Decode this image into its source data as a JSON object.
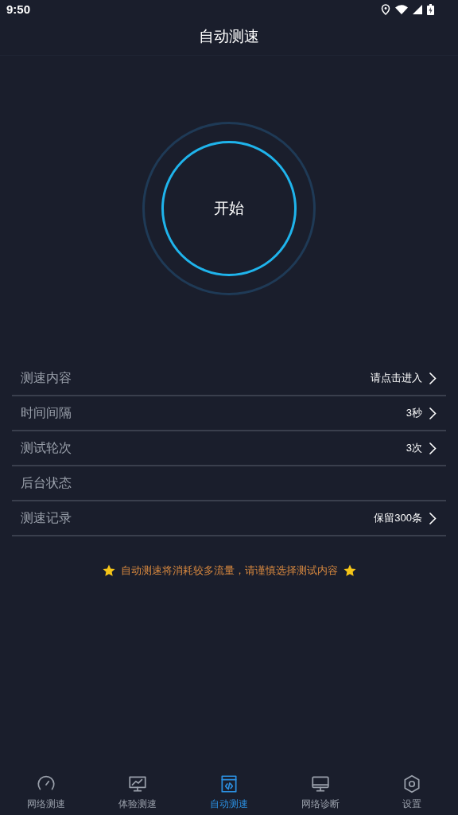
{
  "status_bar": {
    "time": "9:50"
  },
  "header": {
    "title": "自动测速"
  },
  "start_button": {
    "label": "开始"
  },
  "settings": [
    {
      "kind": "link",
      "label": "测速内容",
      "value": "请点击进入"
    },
    {
      "kind": "link",
      "label": "时间间隔",
      "value": "3秒"
    },
    {
      "kind": "link",
      "label": "测试轮次",
      "value": "3次"
    },
    {
      "kind": "plain",
      "label": "后台状态"
    },
    {
      "kind": "link",
      "label": "测速记录",
      "value": "保留300条"
    }
  ],
  "notice": "自动测速将消耗较多流量，请谨慎选择测试内容",
  "nav": [
    {
      "kind": "gauge",
      "label": "网络测速",
      "selected": false
    },
    {
      "kind": "chart",
      "label": "体验测速",
      "selected": false
    },
    {
      "kind": "code",
      "label": "自动测速",
      "selected": true
    },
    {
      "kind": "monitor",
      "label": "网络诊断",
      "selected": false
    },
    {
      "kind": "hexagon",
      "label": "设置",
      "selected": false
    }
  ]
}
